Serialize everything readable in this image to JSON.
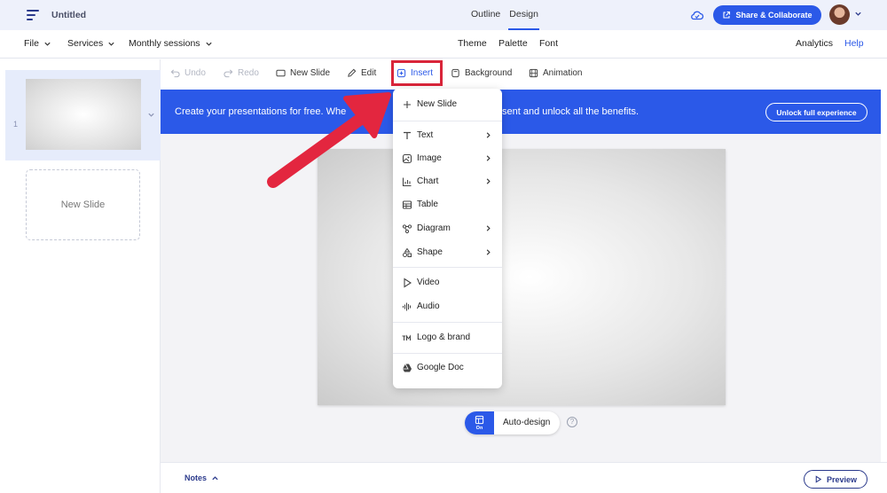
{
  "header": {
    "title": "Untitled",
    "tabs": [
      {
        "label": "Outline"
      },
      {
        "label": "Design"
      }
    ],
    "share_label": "Share & Collaborate"
  },
  "menubar": {
    "file": "File",
    "services": "Services",
    "monthly": "Monthly sessions",
    "theme": "Theme",
    "palette": "Palette",
    "font": "Font",
    "analytics": "Analytics",
    "help": "Help"
  },
  "toolbar": {
    "undo": "Undo",
    "redo": "Redo",
    "new_slide": "New Slide",
    "edit": "Edit",
    "insert": "Insert",
    "background": "Background",
    "animation": "Animation"
  },
  "banner": {
    "text": "Create your presentations for free. Whe",
    "text_end": "sent and unlock all the benefits.",
    "unlock_label": "Unlock full experience"
  },
  "slides_panel": {
    "slide_number": "1",
    "new_slide_label": "New Slide"
  },
  "insert_menu": {
    "items": [
      {
        "label": "New Slide"
      },
      {
        "label": "Text"
      },
      {
        "label": "Image"
      },
      {
        "label": "Chart"
      },
      {
        "label": "Table"
      },
      {
        "label": "Diagram"
      },
      {
        "label": "Shape"
      },
      {
        "label": "Video"
      },
      {
        "label": "Audio"
      },
      {
        "label": "Logo & brand"
      },
      {
        "label": "Google Doc"
      }
    ]
  },
  "auto_design": {
    "toggle_state": "On",
    "label": "Auto-design",
    "help": "?"
  },
  "bottombar": {
    "notes": "Notes",
    "preview": "Preview"
  },
  "colors": {
    "accent": "#2b59e8",
    "highlight": "#d9253a",
    "header_bg": "#eef1fb"
  }
}
